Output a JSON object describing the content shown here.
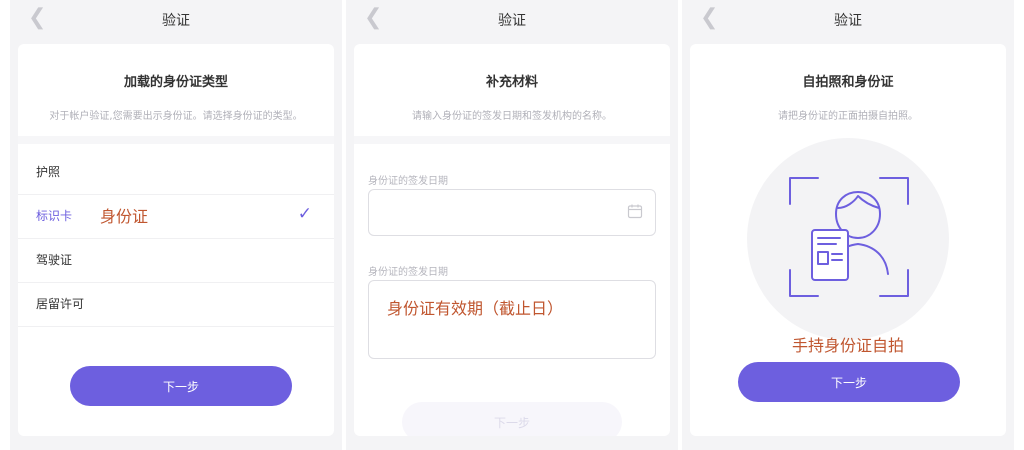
{
  "panels": [
    {
      "title": "验证",
      "card_title": "加载的身份证类型",
      "card_subtitle": "对于帐户验证,您需要出示身份证。请选择身份证的类型。",
      "options": [
        {
          "label": "护照"
        },
        {
          "label": "标识卡",
          "annotation": "身份证",
          "selected": true
        },
        {
          "label": "驾驶证"
        },
        {
          "label": "居留许可"
        }
      ],
      "button": "下一步"
    },
    {
      "title": "验证",
      "card_title": "补充材料",
      "card_subtitle": "请输入身份证的签发日期和签发机构的名称。",
      "field1_label": "身份证的签发日期",
      "field1_value": "",
      "field2_label": "身份证的签发日期",
      "field2_annotation": "身份证有效期（截止日）",
      "button": "下一步"
    },
    {
      "title": "验证",
      "card_title": "自拍照和身份证",
      "card_subtitle": "请把身份证的正面拍摄自拍照。",
      "annotation": "手持身份证自拍",
      "button": "下一步"
    }
  ],
  "icons": {
    "back": "chevron-left-icon",
    "check": "checkmark-icon",
    "calendar": "calendar-icon",
    "selfie": "selfie-with-id-icon"
  },
  "colors": {
    "accent": "#6d5fdf",
    "annotation": "#c0562f",
    "page_bg": "#f4f4f6",
    "card_bg": "#ffffff",
    "button_disabled_bg": "#f7f6fb"
  }
}
